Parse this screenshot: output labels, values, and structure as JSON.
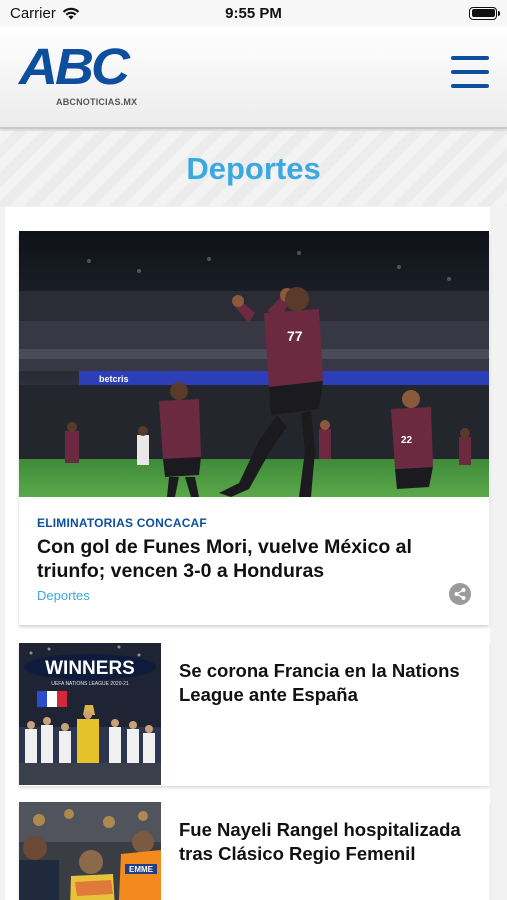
{
  "status_bar": {
    "carrier": "Carrier",
    "time": "9:55 PM",
    "battery_level": 1.0
  },
  "header": {
    "logo_text": "ABC",
    "logo_subtext": "ABCNOTICIAS.MX",
    "menu_icon": "hamburger-icon",
    "brand_color": "#0d4f9c"
  },
  "section": {
    "title": "Deportes",
    "title_color": "#3ba8e0"
  },
  "featured": {
    "kicker": "ELIMINATORIAS CONCACAF",
    "headline": "Con gol de Funes Mori, vuelve México al triunfo; vencen 3-0 a Honduras",
    "section_link": "Deportes",
    "share_icon": "share-icon",
    "image_banner_text": "betcris"
  },
  "articles": [
    {
      "headline": "Se corona Francia en la Nations League ante España",
      "thumb_text": "WINNERS",
      "thumb_subtext": "UEFA NATIONS LEAGUE 2020-21"
    },
    {
      "headline": "Fue Nayeli Rangel hospitalizada tras Clásico Regio Femenil",
      "thumb_text": "EMME"
    }
  ]
}
